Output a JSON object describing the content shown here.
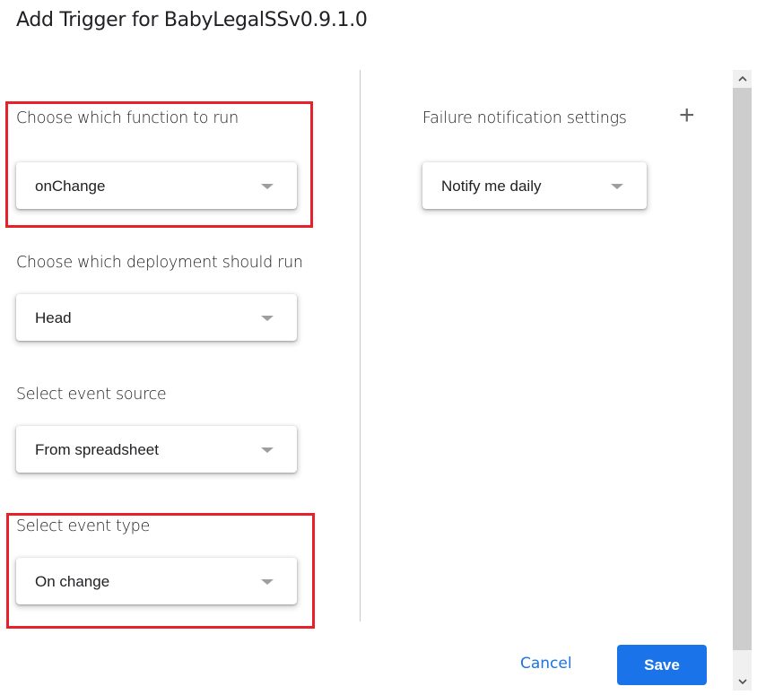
{
  "dialog": {
    "title": "Add Trigger for BabyLegalSSv0.9.1.0"
  },
  "left": {
    "function": {
      "label": "Choose which function to run",
      "value": "onChange"
    },
    "deployment": {
      "label": "Choose which deployment should run",
      "value": "Head"
    },
    "event_source": {
      "label": "Select event source",
      "value": "From spreadsheet"
    },
    "event_type": {
      "label": "Select event type",
      "value": "On change"
    }
  },
  "right": {
    "failure": {
      "label": "Failure notification settings",
      "value": "Notify me daily",
      "add_icon": "+"
    }
  },
  "footer": {
    "cancel": "Cancel",
    "save": "Save"
  },
  "colors": {
    "accent": "#1a73e8",
    "highlight": "#e8202a"
  }
}
